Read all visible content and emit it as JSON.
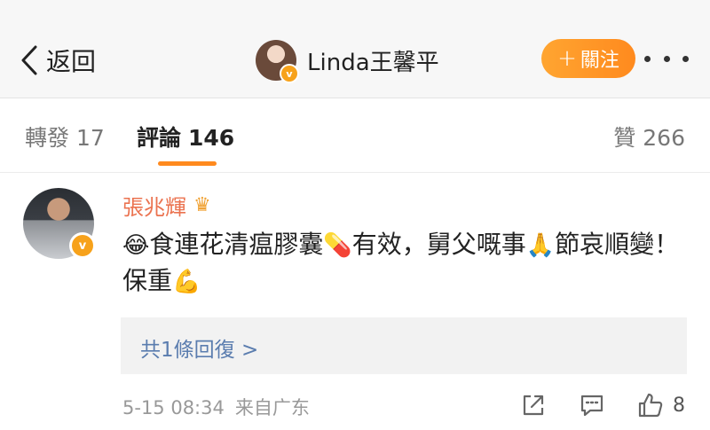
{
  "nav": {
    "back_label": "返回",
    "profile_name": "Linda王馨平",
    "follow_label": "關注",
    "follow_plus": "+",
    "verified_badge": "v"
  },
  "tabs": {
    "repost": {
      "label": "轉發",
      "count": "17"
    },
    "comment": {
      "label": "評論",
      "count": "146"
    },
    "like": {
      "label": "贊",
      "count": "266"
    }
  },
  "comment": {
    "author": "張兆輝",
    "crown_icon": "♛",
    "verified_badge": "v",
    "text_part1": "食連花清瘟膠囊",
    "text_part2": "有效，舅父嘅事",
    "text_part3": "節哀順變！保重",
    "emoji_laugh_cry": "😂",
    "emoji_pill": "💊",
    "emoji_pray": "🙏",
    "emoji_muscle": "💪",
    "reply_summary": "共1條回復 >",
    "date": "5-15 08:34",
    "source": "来自广东",
    "like_count": "8"
  },
  "colors": {
    "accent": "#ff8a1e",
    "name_orange": "#eb7350",
    "link_blue": "#5b7daf"
  }
}
